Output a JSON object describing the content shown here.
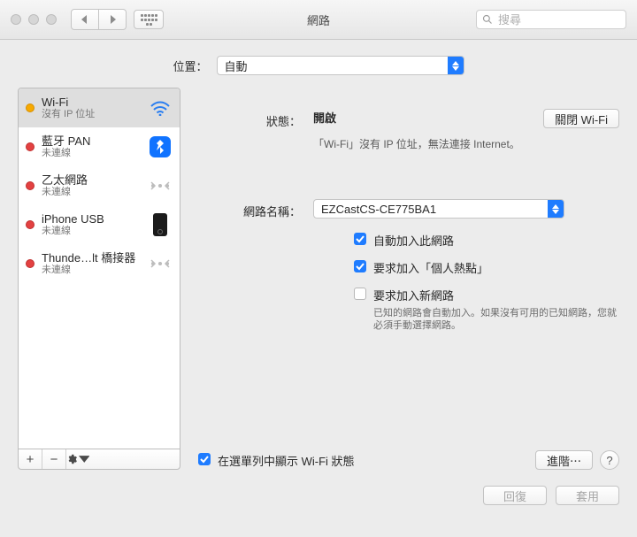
{
  "titlebar": {
    "title": "網路",
    "search_placeholder": "搜尋"
  },
  "location": {
    "label": "位置：",
    "value": "自動"
  },
  "sidebar": {
    "items": [
      {
        "name": "Wi-Fi",
        "sub": "沒有 IP 位址",
        "status": "yellow",
        "icon": "wifi",
        "selected": true
      },
      {
        "name": "藍牙 PAN",
        "sub": "未連線",
        "status": "red",
        "icon": "bluetooth",
        "selected": false
      },
      {
        "name": "乙太網路",
        "sub": "未連線",
        "status": "red",
        "icon": "ethernet",
        "selected": false
      },
      {
        "name": "iPhone USB",
        "sub": "未連線",
        "status": "red",
        "icon": "iphone",
        "selected": false
      },
      {
        "name": "Thunde…lt 橋接器",
        "sub": "未連線",
        "status": "red",
        "icon": "ethernet",
        "selected": false
      }
    ],
    "toolbar": {
      "add": "+",
      "remove": "−",
      "gear": "gear"
    }
  },
  "panel": {
    "status_label": "狀態：",
    "status_value": "開啟",
    "turn_off_label": "關閉 Wi-Fi",
    "status_detail": "「Wi-Fi」沒有 IP 位址，無法連接 Internet。",
    "network_name_label": "網路名稱：",
    "network_name_value": "EZCastCS-CE775BA1",
    "checks": [
      {
        "label": "自動加入此網路",
        "checked": true,
        "help": ""
      },
      {
        "label": "要求加入「個人熱點」",
        "checked": true,
        "help": ""
      },
      {
        "label": "要求加入新網路",
        "checked": false,
        "help": "已知的網路會自動加入。如果沒有可用的已知網路，您就必須手動選擇網路。"
      }
    ],
    "show_in_menu": {
      "label": "在選單列中顯示 Wi-Fi 狀態",
      "checked": true
    },
    "advanced_label": "進階⋯",
    "help_label": "?"
  },
  "footer": {
    "revert": "回復",
    "apply": "套用"
  }
}
